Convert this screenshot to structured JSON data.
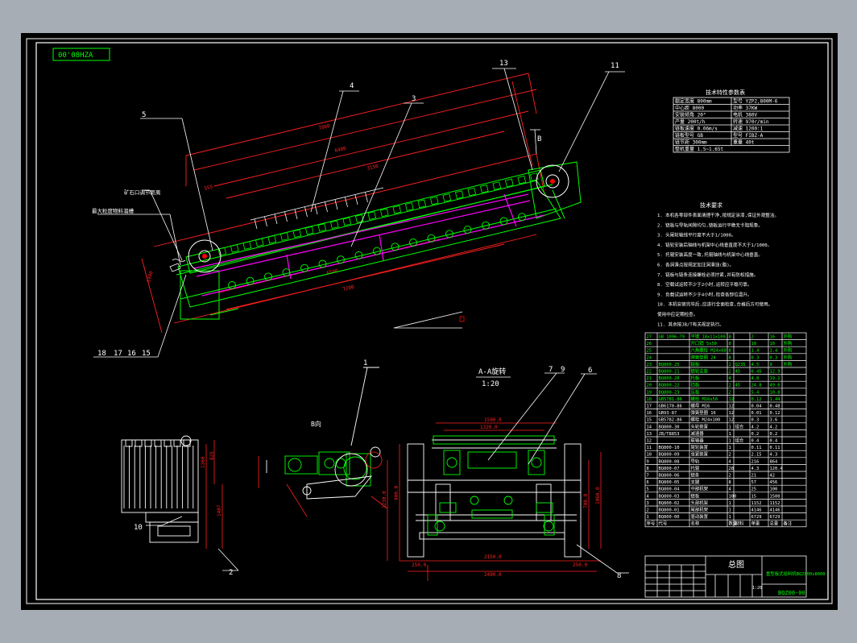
{
  "drawing_number": "00'08HZA",
  "balloons": {
    "n1": "1",
    "n2": "2",
    "n3": "3",
    "n4": "4",
    "n5": "5",
    "n6": "6",
    "n7": "7",
    "n8": "8",
    "n9": "9",
    "n10": "10",
    "n11": "11",
    "n13": "13",
    "n15": "15",
    "n16": "16",
    "n17": "17",
    "n18": "18"
  },
  "section_title": "A-A旋转",
  "section_scale": "1:20",
  "view_b_label": "B向",
  "marker_b": "B",
  "side_labels": [
    "矿石口调节距离",
    "最大粒度物料溜槽"
  ],
  "tech_params_title": "技术特性参数表",
  "tech_params": [
    [
      "额定宽度 800mm",
      "型号 YZP2,800M-6"
    ],
    [
      "中心距 8000",
      "功率 37KW"
    ],
    [
      "安装倾角 20°",
      "电机 380V"
    ],
    [
      "产量 200t/h",
      "转速 970r/min"
    ],
    [
      "链板速度 0.06m/s",
      "减速 1200:1"
    ],
    [
      "链板型号 GB",
      "型号 FIBZ-A"
    ],
    [
      "链节距 300mm",
      "重量 40t"
    ],
    [
      "整机重量 1.5~1.65t",
      ""
    ]
  ],
  "tech_req_title": "技术要求",
  "tech_reqs": [
    "1. 本机各零部件表面清理干净,按规定涂漆,保证外观整洁。",
    "2. 链板与导轨间隙均匀,链板运行平稳无卡阻现象。",
    "3. 头尾轮轴线平行度不大于1/1000。",
    "4. 链轮安装后轴线与机架中心线垂直度不大于1/1000。",
    "5. 托辊安装高度一致,托辊轴线与机架中心线垂直。",
    "6. 各润滑点按规定加注润滑油(脂)。",
    "7. 链板与链条连接螺栓必须拧紧,并有防松措施。",
    "8. 空载试运转不少于2小时,运转应平稳可靠。",
    "9. 负载试运转不少于4小时,检查各部位温升。",
    "10. 本机安装完毕后,应进行全面检查,合格后方可使用。",
    "    使用中应定期检查。",
    "11. 其余按JB/T有关规定执行。"
  ],
  "bom_headers": [
    "序号",
    "代号",
    "名称",
    "数量",
    "材料",
    "单重",
    "总重",
    "备注"
  ],
  "bom_rows": [
    [
      "27",
      "GB 1096-79",
      "平键 18x11x100",
      "8",
      "",
      "2",
      "16",
      "外购"
    ],
    [
      "26",
      "",
      "开口销 5x50",
      "8",
      "",
      "10",
      "10",
      "外购"
    ],
    [
      "25",
      "",
      "六角螺栓 M24x60",
      "8",
      "",
      "1.4",
      "1.4",
      "外购"
    ],
    [
      "24",
      "",
      "弹簧垫圈 24",
      "8",
      "",
      "0.3",
      "0.3",
      "外购"
    ],
    [
      "23",
      "BQ800-25",
      "链板",
      "2",
      "Q235",
      "4.5",
      "9",
      "外购"
    ],
    [
      "22",
      "BQ800-21",
      "链轮支座",
      "2",
      "45",
      "6.45",
      "12.9",
      ""
    ],
    [
      "21",
      "BQ800-20",
      "托板",
      "4",
      "",
      "4.8",
      "19.2",
      ""
    ],
    [
      "20",
      "BQ800-22",
      "挡板",
      "2",
      "45",
      "24.8",
      "49.6",
      ""
    ],
    [
      "19",
      "BQ800-23",
      "压板",
      "2",
      "",
      "5.4",
      "10.8",
      ""
    ],
    [
      "18",
      "GB5781-86",
      "螺栓 M16x50",
      "12",
      "",
      "0.12",
      "1.44",
      ""
    ],
    [
      "17",
      "GB6170-86",
      "螺母 M16",
      "12",
      "",
      "0.04",
      "0.48",
      ""
    ],
    [
      "16",
      "GB93-87",
      "弹簧垫圈 16",
      "12",
      "",
      "0.01",
      "0.12",
      ""
    ],
    [
      "15",
      "GB5782-86",
      "螺栓 M24x100",
      "12",
      "",
      "0.3",
      "3.6",
      ""
    ],
    [
      "14",
      "BQ800-30",
      "头轮装置",
      "1",
      "组合",
      "4.2",
      "4.2",
      ""
    ],
    [
      "13",
      "JB/T8853",
      "减速器",
      "1",
      "",
      "0.2",
      "0.2",
      ""
    ],
    [
      "12",
      "",
      "联轴器",
      "1",
      "组合",
      "0.4",
      "0.4",
      ""
    ],
    [
      "11",
      "BQ800-10",
      "尾轮装置",
      "1",
      "",
      "0.11",
      "0.11",
      ""
    ],
    [
      "10",
      "BQ800-09",
      "张紧装置",
      "2",
      "",
      "2.15",
      "4.3",
      ""
    ],
    [
      "9",
      "BQ800-08",
      "导轨",
      "4",
      "",
      "216",
      "864",
      ""
    ],
    [
      "8",
      "BQ800-07",
      "托辊",
      "28",
      "",
      "4.3",
      "120.4",
      ""
    ],
    [
      "7",
      "BQ800-06",
      "链条",
      "2",
      "",
      "21",
      "42",
      ""
    ],
    [
      "6",
      "BQ800-05",
      "支腿",
      "8",
      "",
      "57",
      "456",
      ""
    ],
    [
      "5",
      "BQ800-04",
      "中部机架",
      "4",
      "",
      "25",
      "100",
      ""
    ],
    [
      "4",
      "BQ800-03",
      "链板",
      "100",
      "",
      "15",
      "1500",
      ""
    ],
    [
      "3",
      "BQ800-02",
      "头部机架",
      "1",
      "",
      "1152",
      "1152",
      ""
    ],
    [
      "2",
      "BQ800-01",
      "尾部机架",
      "1",
      "",
      "4146",
      "4146",
      ""
    ],
    [
      "1",
      "BQ800-00",
      "驱动装置",
      "1",
      "",
      "6729",
      "6729",
      ""
    ]
  ],
  "title_block": {
    "drawing_title": "总图",
    "product_name": "重型板式给料机BQZ800x8000",
    "drawing_code": "BQZ00-00",
    "scale": "1:20",
    "sheet": "第1张"
  },
  "colors": {
    "background": "#000000",
    "frame": "#ffffff",
    "drawing_green": "#00ff00",
    "dimension_red": "#ff2020",
    "chain_magenta": "#ff00ff",
    "leader_white": "#ffffff"
  }
}
